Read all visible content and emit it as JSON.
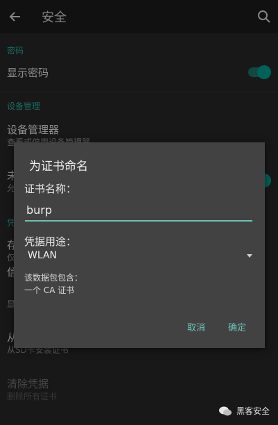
{
  "appbar": {
    "title": "安全",
    "back_icon": "arrow-left-icon",
    "search_icon": "search-icon"
  },
  "settings": {
    "password_section": "密码",
    "show_password": "显示密码",
    "show_password_on": true,
    "device_admin_section": "设备管理",
    "device_admin_title": "设备管理器",
    "device_admin_sub": "查看或停用设备管理器",
    "unknown_title": "未",
    "unknown_sub": "允",
    "cred_section": "凭",
    "storage_title": "存",
    "storage_sub": "仅",
    "trusted_title": "信",
    "trusted_sub": "显",
    "install_title": "从",
    "install_sub": "从SD卡安装证书",
    "clear_title": "清除凭据",
    "clear_sub": "删除所有证书"
  },
  "dialog": {
    "title": "为证书命名",
    "name_label": "证书名称：",
    "name_value": "burp",
    "usage_label": "凭据用途：",
    "usage_value": "WLAN",
    "info_line1": "该数据包包含：",
    "info_line2": "一个 CA 证书",
    "cancel": "取消",
    "ok": "确定"
  },
  "watermark": {
    "text": "黑客安全"
  },
  "colors": {
    "accent": "#009688",
    "dialog_bg": "#424242",
    "appbar_bg": "#1b1b1b"
  }
}
